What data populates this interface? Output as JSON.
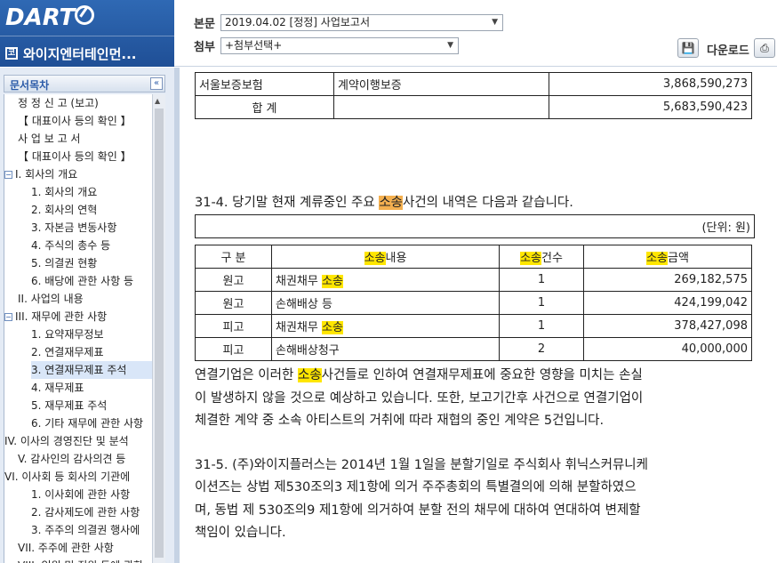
{
  "header": {
    "logo": "DART",
    "company_icon": "코",
    "company_name": "와이지엔터테인먼...",
    "body_label": "본문",
    "body_value": "2019.04.02  [정정] 사업보고서",
    "attach_label": "첨부",
    "attach_value": "+첨부선택+",
    "download_label": "다운로드",
    "icons": [
      "save-icon",
      "print-icon"
    ]
  },
  "toc": {
    "title": "문서목차",
    "items": [
      {
        "label": "정 정 신 고 (보고)"
      },
      {
        "label": "【 대표이사 등의 확인 】"
      },
      {
        "label": "사 업 보 고 서"
      },
      {
        "label": "【 대표이사 등의 확인 】"
      },
      {
        "label": "I. 회사의 개요",
        "exp": "−"
      },
      {
        "label": "1. 회사의 개요"
      },
      {
        "label": "2. 회사의 연혁"
      },
      {
        "label": "3. 자본금 변동사항"
      },
      {
        "label": "4. 주식의 총수 등"
      },
      {
        "label": "5. 의결권 현황"
      },
      {
        "label": "6. 배당에 관한 사항 등"
      },
      {
        "label": "II. 사업의 내용"
      },
      {
        "label": "III. 재무에 관한 사항",
        "exp": "−"
      },
      {
        "label": "1. 요약재무정보"
      },
      {
        "label": "2. 연결재무제표"
      },
      {
        "label": "3. 연결재무제표 주석"
      },
      {
        "label": "4. 재무제표"
      },
      {
        "label": "5. 재무제표 주석"
      },
      {
        "label": "6. 기타 재무에 관한 사항"
      },
      {
        "label": "IV. 이사의 경영진단 및 분석"
      },
      {
        "label": "V. 감사인의 감사의견 등"
      },
      {
        "label": "VI. 이사회 등 회사의 기관에"
      },
      {
        "label": "1. 이사회에 관한 사항"
      },
      {
        "label": "2. 감사제도에 관한 사항"
      },
      {
        "label": "3. 주주의 의결권 행사에"
      },
      {
        "label": "VII. 주주에 관한 사항"
      },
      {
        "label": "VIII. 임원 및 직원 등에 관한"
      }
    ],
    "selected": 15
  },
  "content": {
    "top_table": [
      [
        "서울보증보험",
        "계약이행보증",
        "3,868,590,273"
      ],
      [
        "합   계",
        "",
        "5,683,590,423"
      ]
    ],
    "sec314_prefix": "31-4. 당기말 현재 계류중인 주요 ",
    "sec314_hl": "소송",
    "sec314_suffix": "사건의 내역은 다음과 같습니다.",
    "unit": "(단위: 원)",
    "lawsuit_headers": {
      "col1": "구  분",
      "col2_hl": "소송",
      "col2_rest": "내용",
      "col3_hl": "소송",
      "col3_rest": "건수",
      "col4_hl": "소송",
      "col4_rest": "금액"
    },
    "lawsuit_rows": [
      {
        "type": "원고",
        "content": "채권채무 ",
        "content_hl": "소송",
        "count": "1",
        "amount": "269,182,575"
      },
      {
        "type": "원고",
        "content": "손해배상 등",
        "content_hl": "",
        "count": "1",
        "amount": "424,199,042"
      },
      {
        "type": "피고",
        "content": "채권채무 ",
        "content_hl": "소송",
        "count": "1",
        "amount": "378,427,098"
      },
      {
        "type": "피고",
        "content": "손해배상청구",
        "content_hl": "",
        "count": "2",
        "amount": "40,000,000"
      }
    ],
    "para1_line1_a": "연결기업은 이러한 ",
    "para1_line1_hl": "소송",
    "para1_line1_b": "사건들로 인하여 연결재무제표에 중요한 영향을 미치는 손실",
    "para1_line2": "이 발생하지 않을 것으로 예상하고 있습니다. 또한, 보고기간후 사건으로 연결기업이",
    "para1_line3": "체결한 계약 중 소속 아티스트의 거취에 따라 재협의 중인 계약은 5건입니다.",
    "para2_lines": [
      "31-5. (주)와이지플러스는 2014년 1월 1일을 분할기일로 주식회사 휘닉스커뮤니케",
      "이션즈는 상법 제530조의3 제1항에 의거 주주총회의 특별결의에 의해 분할하였으",
      "며, 동법 제 530조의9 제1항에 의거하여 분할 전의 채무에 대하여 연대하여 변제할",
      "책임이 있습니다."
    ]
  }
}
